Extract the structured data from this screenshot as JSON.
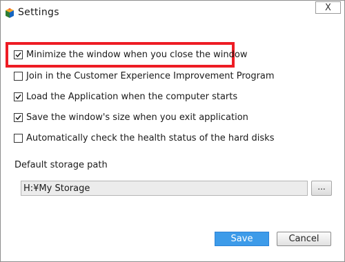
{
  "window": {
    "title": "Settings",
    "close_label": "X"
  },
  "options": [
    {
      "label": "Minimize the window when you close the window",
      "checked": true,
      "highlighted": true
    },
    {
      "label": "Join in the Customer Experience Improvement Program",
      "checked": false
    },
    {
      "label": "Load the Application when the computer starts",
      "checked": true
    },
    {
      "label": "Save the window's size when you exit application",
      "checked": true
    },
    {
      "label": "Automatically check the health status of the hard disks",
      "checked": false
    }
  ],
  "storage": {
    "label": "Default storage path",
    "value": "H:¥My Storage",
    "browse_label": "..."
  },
  "buttons": {
    "save": "Save",
    "cancel": "Cancel"
  },
  "colors": {
    "highlight": "#ee1c24",
    "save_button": "#3d9be9"
  }
}
